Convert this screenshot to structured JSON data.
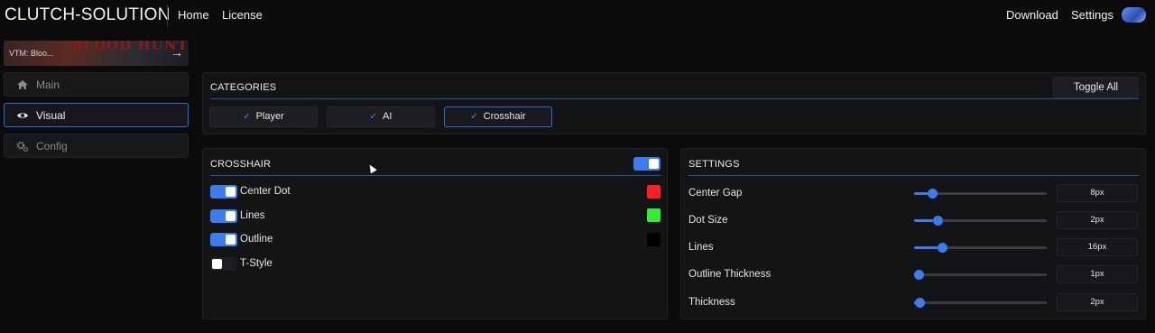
{
  "nav": {
    "brand": "CLUTCH-SOLUTION",
    "links": [
      "Home",
      "License"
    ],
    "right_links": [
      "Download",
      "Settings"
    ],
    "avatar_icon": "user-avatar-icon"
  },
  "sidebar": {
    "game": {
      "name": "VTM: Bloo...",
      "art_text": "BLOOD HUNT",
      "arrow_icon": "arrow-right-icon"
    },
    "items": [
      {
        "label": "Main",
        "icon": "home-icon",
        "active": false
      },
      {
        "label": "Visual",
        "icon": "eye-icon",
        "active": true
      },
      {
        "label": "Config",
        "icon": "gears-icon",
        "active": false
      }
    ]
  },
  "categories": {
    "title": "CATEGORIES",
    "toggle_all_label": "Toggle All",
    "items": [
      {
        "label": "Player",
        "checked": true,
        "selected": false
      },
      {
        "label": "AI",
        "checked": true,
        "selected": false
      },
      {
        "label": "Crosshair",
        "checked": true,
        "selected": true
      }
    ]
  },
  "crosshair": {
    "title": "CROSSHAIR",
    "enabled": true,
    "rows": [
      {
        "label": "Center Dot",
        "enabled": true,
        "color": "#ff1f1f"
      },
      {
        "label": "Lines",
        "enabled": true,
        "color": "#2ef02e"
      },
      {
        "label": "Outline",
        "enabled": true,
        "color": "#000000"
      },
      {
        "label": "T-Style",
        "enabled": false,
        "color": null
      }
    ]
  },
  "settings": {
    "title": "SETTINGS",
    "sliders": [
      {
        "label": "Center Gap",
        "value": "8px",
        "fraction": 0.1
      },
      {
        "label": "Dot Size",
        "value": "2px",
        "fraction": 0.14
      },
      {
        "label": "Lines",
        "value": "16px",
        "fraction": 0.18
      },
      {
        "label": "Outline Thickness",
        "value": "1px",
        "fraction": 0.0
      },
      {
        "label": "Thickness",
        "value": "2px",
        "fraction": 0.01
      }
    ]
  },
  "colors": {
    "accent": "#3b7cf0",
    "background": "#0b0b0c",
    "panel": "#131416"
  }
}
